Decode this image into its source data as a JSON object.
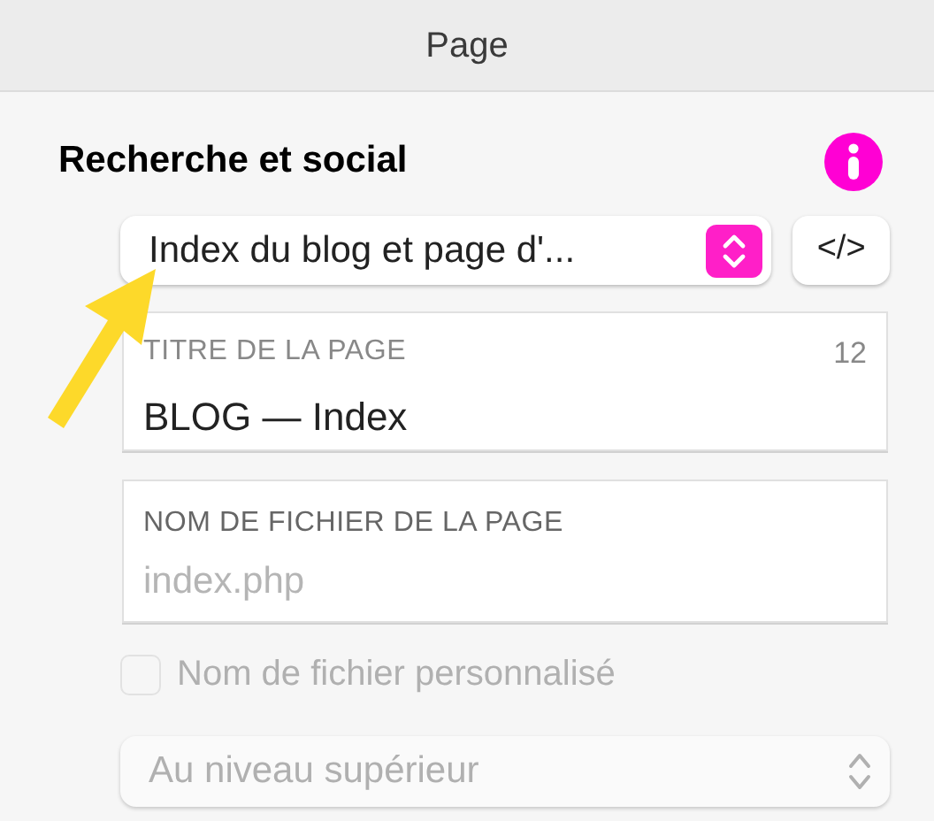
{
  "header": {
    "title": "Page"
  },
  "section": {
    "title": "Recherche et social"
  },
  "page_type_select": {
    "value": "Index du blog et page d'...",
    "disabled": false
  },
  "code_button": {
    "label": "</>"
  },
  "title_field": {
    "label": "TITRE DE LA PAGE",
    "count": "12",
    "value": "BLOG — Index",
    "disabled": false
  },
  "filename_field": {
    "label": "NOM DE FICHIER DE LA PAGE",
    "value": "index.php",
    "disabled": true
  },
  "custom_filename": {
    "label": "Nom de fichier personnalisé",
    "checked": false,
    "disabled": true
  },
  "level_select": {
    "value": "Au niveau supérieur",
    "disabled": true
  }
}
